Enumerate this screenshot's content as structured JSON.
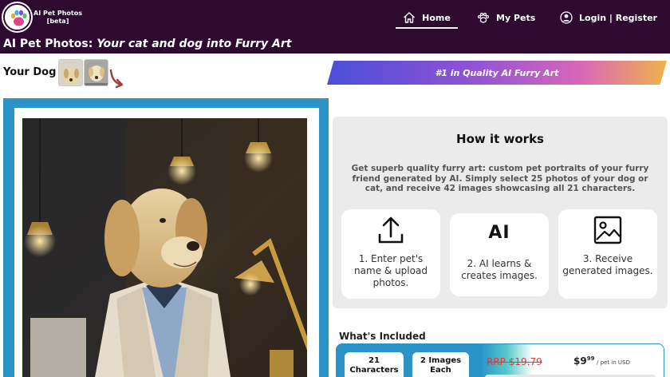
{
  "nav": {
    "brand_line1": "AI Pet Photos",
    "brand_line2": "[beta]",
    "home": "Home",
    "my_pets": "My Pets",
    "login": "Login | Register"
  },
  "title": {
    "prefix": "AI Pet Photos: ",
    "tagline": "Your cat and dog into Furry Art"
  },
  "your_dog": {
    "label": "Your Dog"
  },
  "banner": {
    "text": "#1 in Quality AI Furry Art"
  },
  "how": {
    "title": "How it works",
    "description": "Get superb quality furry art: custom pet portraits of your furry friend generated by AI. Simply select 25 photos of your dog or cat, and receive 42 images showcasing all 21 characters.",
    "steps": [
      {
        "icon": "upload-icon",
        "text": "1. Enter pet's name & upload photos."
      },
      {
        "icon": "ai-icon",
        "glyph": "AI",
        "text": "2. AI learns & creates images."
      },
      {
        "icon": "image-icon",
        "text": "3. Receive generated images."
      }
    ]
  },
  "included": {
    "title": "What's Included",
    "chip1": "21 Characters",
    "chip2": "2 Images Each",
    "rrp": "RRP $19.79",
    "price_main": "$9",
    "price_cents": "99",
    "unit": "/ pet in USD"
  },
  "colors": {
    "nav_bg": "#2e0a31",
    "frame": "#2b93c8",
    "rrp": "#e03a3a"
  }
}
